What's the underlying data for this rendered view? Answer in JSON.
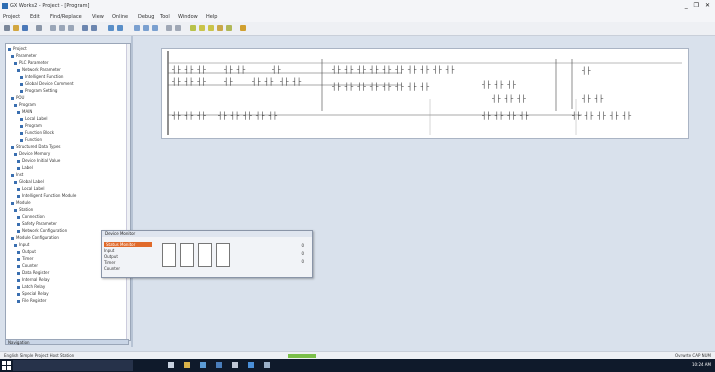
{
  "window": {
    "title": "GX Works2 - Project - [Program]",
    "controls": "_ ❐ ✕"
  },
  "menu": [
    "Project",
    "Edit",
    "Find/Replace",
    "View",
    "Online",
    "Debug",
    "Tool",
    "Window",
    "Help"
  ],
  "tree": {
    "items": [
      "Project",
      "Parameter",
      "PLC Parameter",
      "Network Parameter",
      "Intelligent Function",
      "Global Device Comment",
      "Program Setting",
      "POU",
      "Program",
      "MAIN",
      "Local Label",
      "Program",
      "Function Block",
      "Function",
      "Structured Data Types",
      "Device Memory",
      "Device Initial Value",
      "Label",
      "Inst",
      "Global Label",
      "Local Label",
      "Intelligent Function Module",
      "Module",
      "Station",
      "Connection",
      "Safety Parameter",
      "Network Configuration",
      "Module Configuration",
      "Input",
      "Output",
      "Timer",
      "Counter",
      "Data Register",
      "Internal Relay",
      "Latch Relay",
      "Special Relay",
      "File Register"
    ],
    "bottom_tab": "Navigation"
  },
  "float_panel": {
    "title": "Device Monitor",
    "selected": "Status Monitor",
    "rows": [
      "Input",
      "Output",
      "Timer",
      "Counter"
    ],
    "values": [
      "0",
      "0",
      "0"
    ]
  },
  "status": {
    "left": "English  Simple Project  Host Station",
    "right": "Ovrwrte  CAP  NUM"
  },
  "taskbar": {
    "clock": "10:24 AM"
  },
  "colors": {
    "accent": "#e06a2b",
    "status_green": "#7bbf4a",
    "taskbar": "#0f1a2b"
  }
}
